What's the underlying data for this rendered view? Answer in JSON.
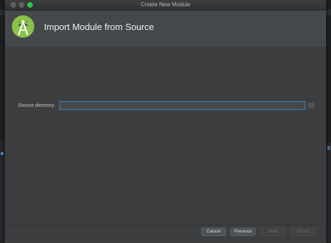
{
  "window": {
    "title": "Create New Module"
  },
  "header": {
    "title": "Import Module from Source",
    "logo_icon": "android-studio-icon"
  },
  "form": {
    "source_directory": {
      "label": "Source directory:",
      "value": "",
      "browse_label": "..."
    }
  },
  "footer": {
    "cancel_label": "Cancel",
    "previous_label": "Previous",
    "next_label": "Next",
    "finish_label": "Finish"
  },
  "colors": {
    "accent_green": "#2ec845",
    "android_green": "#8bc34a",
    "input_focus_border": "#4f6f8f"
  }
}
